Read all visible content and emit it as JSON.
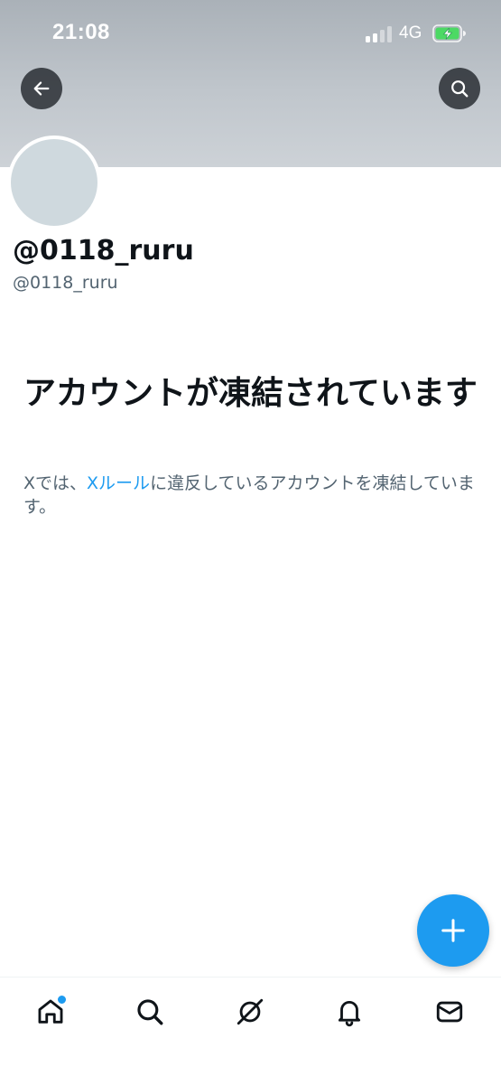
{
  "status_bar": {
    "time": "21:08",
    "network": "4G",
    "signal_bars_active": 2,
    "signal_bars_total": 4
  },
  "header": {
    "back_icon": "arrow-left-icon",
    "search_icon": "search-icon"
  },
  "profile": {
    "display_name": "@0118_ruru",
    "handle": "@0118_ruru"
  },
  "suspended": {
    "title": "アカウントが凍結されています",
    "desc_prefix": "Xでは、",
    "rules_link": "Xルール",
    "desc_suffix": "に違反しているアカウントを凍結しています。"
  },
  "fab": {
    "icon": "plus-icon"
  },
  "bottom_nav": {
    "items": [
      {
        "name": "home",
        "icon": "home-icon",
        "has_notification_dot": true
      },
      {
        "name": "explore",
        "icon": "search-icon"
      },
      {
        "name": "grok",
        "icon": "grok-icon"
      },
      {
        "name": "notifications",
        "icon": "bell-icon"
      },
      {
        "name": "messages",
        "icon": "mail-icon"
      }
    ]
  },
  "colors": {
    "accent": "#1d9bf0",
    "text_primary": "#0f1419",
    "text_secondary": "#536471",
    "avatar_placeholder": "#cfd9de",
    "battery_charging": "#4cd964"
  }
}
